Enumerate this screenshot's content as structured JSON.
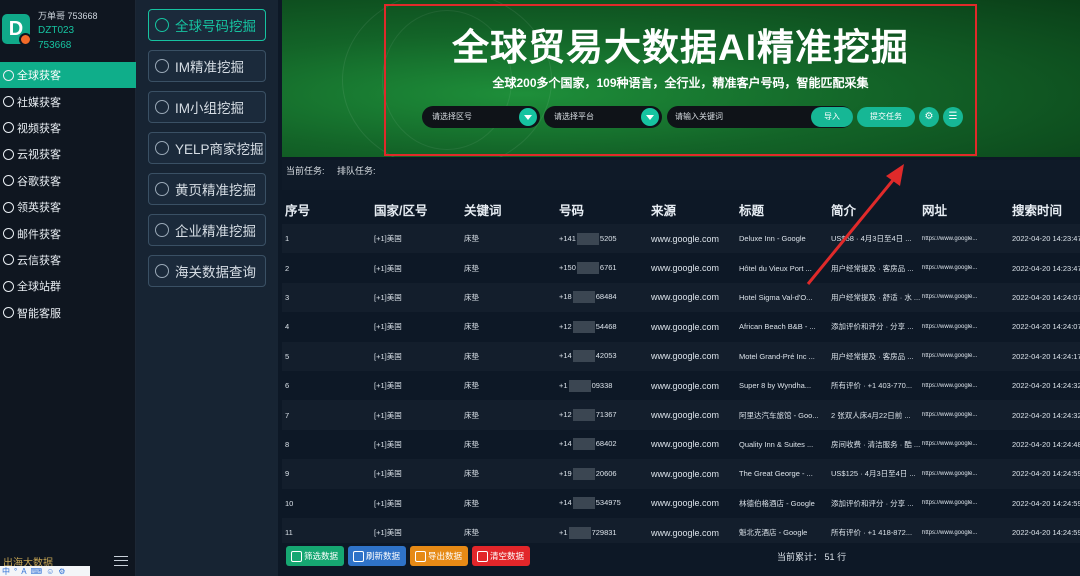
{
  "user": {
    "name_line": "万单哥 753668",
    "id1": "DZT023",
    "id2": "753668",
    "logo_letter": "D"
  },
  "nav": [
    {
      "label": "全球获客",
      "icon": "globe-icon"
    },
    {
      "label": "社媒获客",
      "icon": "social-icon"
    },
    {
      "label": "视频获客",
      "icon": "video-icon"
    },
    {
      "label": "云视获客",
      "icon": "cloud-video-icon"
    },
    {
      "label": "谷歌获客",
      "icon": "google-icon"
    },
    {
      "label": "领英获客",
      "icon": "linkedin-icon"
    },
    {
      "label": "邮件获客",
      "icon": "mail-icon"
    },
    {
      "label": "云信获客",
      "icon": "message-icon"
    },
    {
      "label": "全球站群",
      "icon": "sites-icon"
    },
    {
      "label": "智能客服",
      "icon": "service-icon"
    }
  ],
  "sidebar_bottom": {
    "brand": "出海大数据"
  },
  "ime_bar": [
    "中",
    "°",
    "A",
    "⌨",
    "☺",
    "⚙"
  ],
  "menu": [
    {
      "label": "全球号码挖掘"
    },
    {
      "label": "IM精准挖掘"
    },
    {
      "label": "IM小组挖掘"
    },
    {
      "label": "YELP商家挖掘"
    },
    {
      "label": "黄页精准挖掘"
    },
    {
      "label": "企业精准挖掘"
    },
    {
      "label": "海关数据查询"
    }
  ],
  "banner": {
    "title": "全球贸易大数据AI精准挖掘",
    "subtitle": "全球200多个国家，109种语言，全行业，精准客户号码，智能匹配采集",
    "region_placeholder": "请选择区号",
    "platform_placeholder": "请选择平台",
    "keyword_placeholder": "请输入关键词",
    "import_label": "导入",
    "submit_label": "提交任务"
  },
  "tasks": {
    "current": "当前任务:",
    "queue": "排队任务:"
  },
  "table": {
    "headers": [
      "序号",
      "国家/区号",
      "关键词",
      "号码",
      "来源",
      "标题",
      "简介",
      "网址",
      "搜索时间"
    ],
    "rows": [
      [
        "1",
        "[+1]美国",
        "床垫",
        "+141",
        "5205",
        "www.google.com",
        "Deluxe Inn - Google",
        "US$58 · 4月3日至4日 ...",
        "https://www.google...",
        "2022-04-20 14:23:47"
      ],
      [
        "2",
        "[+1]美国",
        "床垫",
        "+150",
        "6761",
        "www.google.com",
        "Hôtel du Vieux Port ...",
        "用户经常提及 · 客房品 ...",
        "https://www.google...",
        "2022-04-20 14:23:47"
      ],
      [
        "3",
        "[+1]美国",
        "床垫",
        "+18",
        "68484",
        "www.google.com",
        "Hotel Sigma Val-d'O...",
        "用户经常提及 · 舒适 · 水 ...",
        "https://www.google...",
        "2022-04-20 14:24:07"
      ],
      [
        "4",
        "[+1]美国",
        "床垫",
        "+12",
        "54468",
        "www.google.com",
        "African Beach B&B - ...",
        "添加评价和评分 · 分享 ...",
        "https://www.google...",
        "2022-04-20 14:24:07"
      ],
      [
        "5",
        "[+1]美国",
        "床垫",
        "+14",
        "42053",
        "www.google.com",
        "Motel Grand-Pré Inc ...",
        "用户经常提及 · 客房品 ...",
        "https://www.google...",
        "2022-04-20 14:24:17"
      ],
      [
        "6",
        "[+1]美国",
        "床垫",
        "+1",
        "09338",
        "www.google.com",
        "Super 8 by Wyndha...",
        "所有评价 · +1 403-770...",
        "https://www.google...",
        "2022-04-20 14:24:32"
      ],
      [
        "7",
        "[+1]美国",
        "床垫",
        "+12",
        "71367",
        "www.google.com",
        "阿里达汽车旅馆 - Goo...",
        "2 张双人床4月22日前 ...",
        "https://www.google...",
        "2022-04-20 14:24:32"
      ],
      [
        "8",
        "[+1]美国",
        "床垫",
        "+14",
        "68402",
        "www.google.com",
        "Quality Inn & Suites ...",
        "房间收费 · 清洁服务 · 酷 ...",
        "https://www.google...",
        "2022-04-20 14:24:48"
      ],
      [
        "9",
        "[+1]美国",
        "床垫",
        "+19",
        "20606",
        "www.google.com",
        "The Great George - ...",
        "US$125 · 4月3日至4日 ...",
        "https://www.google...",
        "2022-04-20 14:24:59"
      ],
      [
        "10",
        "[+1]美国",
        "床垫",
        "+14",
        "534975",
        "www.google.com",
        "林德伯格酒店 - Google",
        "添加评价和评分 · 分享 ...",
        "https://www.google...",
        "2022-04-20 14:24:59"
      ],
      [
        "11",
        "[+1]美国",
        "床垫",
        "+1",
        "729831",
        "www.google.com",
        "魁北克酒店 - Google",
        "所有评价 · +1 418-872...",
        "https://www.google...",
        "2022-04-20 14:24:59"
      ]
    ]
  },
  "footer": {
    "buttons": [
      {
        "label": "筛选数据",
        "color": "#16a772"
      },
      {
        "label": "刷新数据",
        "color": "#2f73c8"
      },
      {
        "label": "导出数据",
        "color": "#e68a16"
      },
      {
        "label": "清空数据",
        "color": "#e2262a"
      }
    ],
    "count_label": "当前累计：",
    "count_value": "51",
    "count_unit": "行"
  },
  "colors": {
    "accent": "#16c3a0",
    "highlight": "#e02a2a",
    "banner": "#136428"
  }
}
